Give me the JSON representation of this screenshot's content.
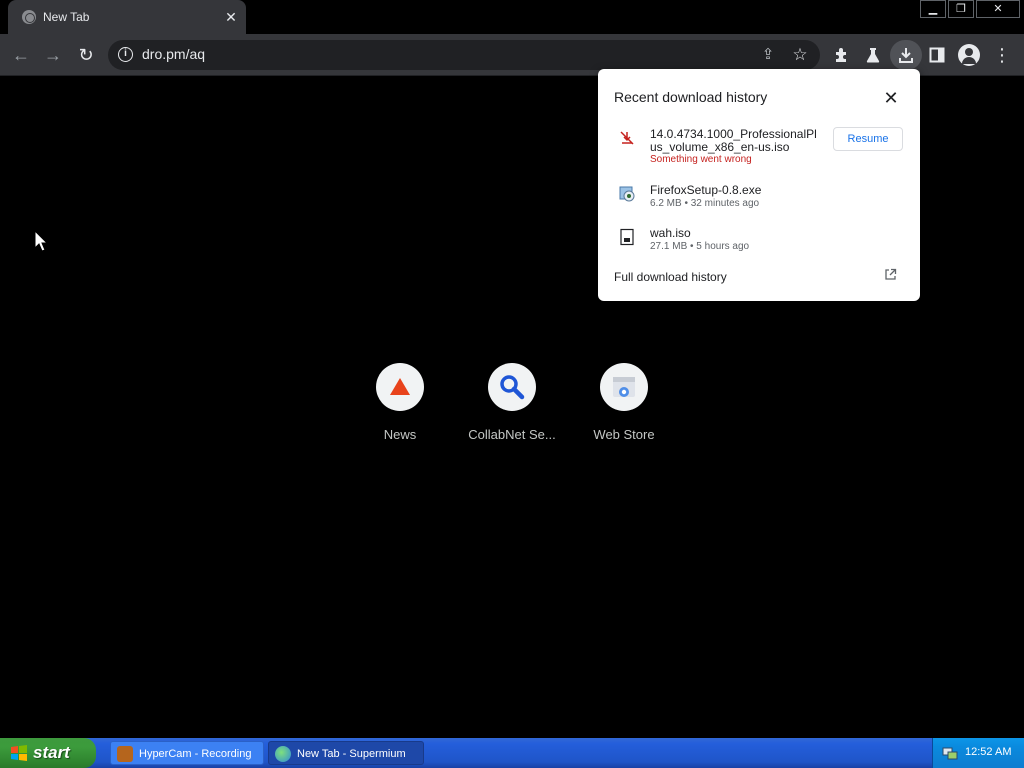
{
  "browser": {
    "tab": {
      "title": "New Tab"
    },
    "url": "dro.pm/aq"
  },
  "shortcuts": [
    {
      "label": "News",
      "icon": "triangle-icon",
      "color": "#e8431b"
    },
    {
      "label": "CollabNet Se...",
      "icon": "magnifier-icon",
      "color": "#1f56d6"
    },
    {
      "label": "Web Store",
      "icon": "webstore-icon",
      "color": "#4f8ee8"
    }
  ],
  "download_bubble": {
    "title": "Recent download history",
    "items": [
      {
        "name": "14.0.4734.1000_ProfessionalPlus_volume_x86_en-us.iso",
        "status": "Something went wrong",
        "action": "Resume",
        "icon": "download-failed-icon"
      },
      {
        "name": "FirefoxSetup-0.8.exe",
        "status": "6.2 MB • 32 minutes ago",
        "icon": "exe-file-icon"
      },
      {
        "name": "wah.iso",
        "status": "27.1 MB • 5 hours ago",
        "icon": "iso-file-icon"
      }
    ],
    "footer_link": "Full download history"
  },
  "taskbar": {
    "start_label": "start",
    "tasks": [
      {
        "label": "HyperCam - Recording"
      },
      {
        "label": "New Tab - Supermium"
      }
    ],
    "clock": "12:52 AM"
  }
}
